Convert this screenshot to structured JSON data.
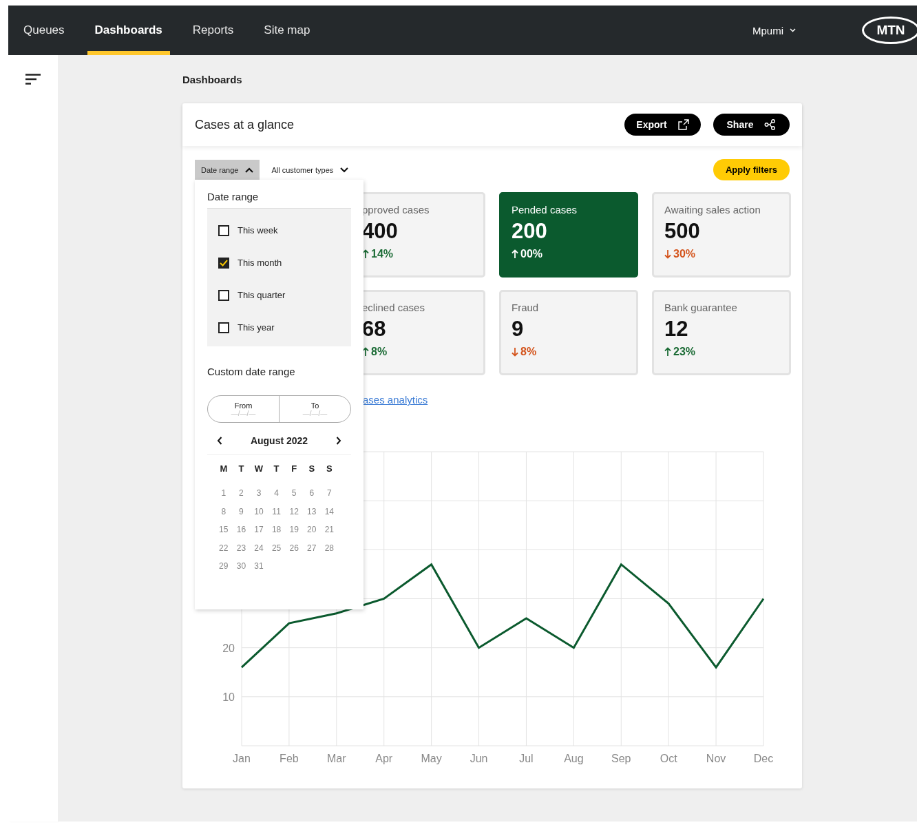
{
  "nav": {
    "tabs": [
      {
        "label": "Queues",
        "selected": false
      },
      {
        "label": "Dashboards",
        "selected": true
      },
      {
        "label": "Reports",
        "selected": false
      },
      {
        "label": "Site map",
        "selected": false
      }
    ],
    "user": "Mpumi",
    "logo": "MTN"
  },
  "breadcrumb": "Dashboards",
  "panel": {
    "title": "Cases at a glance",
    "actions": [
      {
        "label": "Export",
        "kind": "export"
      },
      {
        "label": "Share",
        "kind": "share"
      }
    ],
    "filters": [
      {
        "label": "Date range",
        "expanded": true
      },
      {
        "label": "All customer types",
        "expanded": false
      }
    ],
    "apply": "Apply filters",
    "stats": [
      {
        "label": "pproved cases",
        "value": "400",
        "change": "14%",
        "kind": "up",
        "selected": false
      },
      {
        "label": "Pended cases",
        "value": "200",
        "change": "00%",
        "kind": "up",
        "selected": true
      },
      {
        "label": "Awaiting sales action",
        "value": "500",
        "change": "30%",
        "kind": "down",
        "selected": false
      },
      {
        "label": "eclined cases",
        "value": "68",
        "change": "8%",
        "kind": "up",
        "selected": false
      },
      {
        "label": "Fraud",
        "value": "9",
        "change": "8%",
        "kind": "down",
        "selected": false
      },
      {
        "label": "Bank guarantee",
        "value": "12",
        "change": "23%",
        "kind": "up",
        "selected": false
      }
    ],
    "link": "ases analytics",
    "chart_data": {
      "type": "line",
      "grid": true,
      "categories": [
        "Jan",
        "Feb",
        "Mar",
        "Apr",
        "May",
        "Jun",
        "Jul",
        "Aug",
        "Sep",
        "Oct",
        "Nov",
        "Dec"
      ],
      "ylim": [
        0,
        60
      ],
      "yticks": [
        10,
        20
      ],
      "series": [
        {
          "color": "#0b5a2e",
          "values": [
            16,
            25,
            27,
            30,
            37,
            20,
            26,
            20,
            37,
            29,
            16,
            30
          ]
        }
      ]
    }
  },
  "dropdown": {
    "title": "Date range",
    "options": [
      {
        "label": "This week",
        "checked": false
      },
      {
        "label": "This month",
        "checked": true
      },
      {
        "label": "This quarter",
        "checked": false
      },
      {
        "label": "This year",
        "checked": false
      }
    ],
    "custom_title": "Custom date range",
    "fields": [
      {
        "label": "From",
        "placeholder": "—/—/—"
      },
      {
        "label": "To",
        "placeholder": "—/—/—"
      }
    ],
    "calendar": {
      "month": "August 2022",
      "weekdays": [
        "M",
        "T",
        "W",
        "T",
        "F",
        "S",
        "S"
      ],
      "days": [
        "1",
        "2",
        "3",
        "4",
        "5",
        "6",
        "7",
        "8",
        "9",
        "10",
        "11",
        "12",
        "13",
        "14",
        "15",
        "16",
        "17",
        "18",
        "19",
        "20",
        "21",
        "22",
        "23",
        "24",
        "25",
        "26",
        "27",
        "28",
        "29",
        "30",
        "31"
      ]
    }
  }
}
